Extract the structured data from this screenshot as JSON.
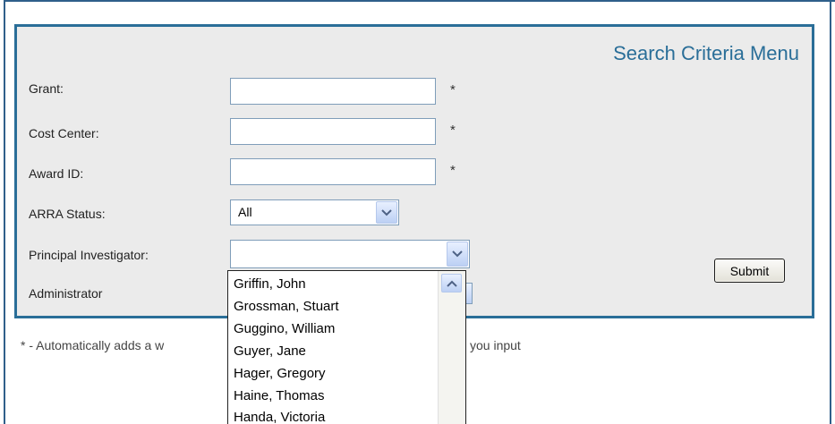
{
  "panel": {
    "title": "Search Criteria Menu"
  },
  "fields": {
    "grant": {
      "label": "Grant:",
      "value": "",
      "marker": "*"
    },
    "cost_center": {
      "label": "Cost Center:",
      "value": "",
      "marker": "*"
    },
    "award_id": {
      "label": "Award ID:",
      "value": "",
      "marker": "*"
    },
    "arra_status": {
      "label": "ARRA Status:",
      "selected": "All"
    },
    "principal_investigator": {
      "label": "Principal Investigator:",
      "selected": ""
    },
    "administrator": {
      "label": "Administrator"
    }
  },
  "submit_label": "Submit",
  "footnote": {
    "left": "* - Automatically adds a w",
    "right": "you input"
  },
  "pi_dropdown": {
    "options": [
      "Griffin, John",
      "Grossman, Stuart",
      "Guggino, William",
      "Guyer, Jane",
      "Hager, Gregory",
      "Haine, Thomas",
      "Handa, Victoria"
    ]
  },
  "icons": {
    "dropdown_arrow": "chevron-down-icon",
    "scroll_up": "chevron-up-icon"
  },
  "colors": {
    "accent": "#2a6e98",
    "panel_bg": "#ebebeb"
  }
}
